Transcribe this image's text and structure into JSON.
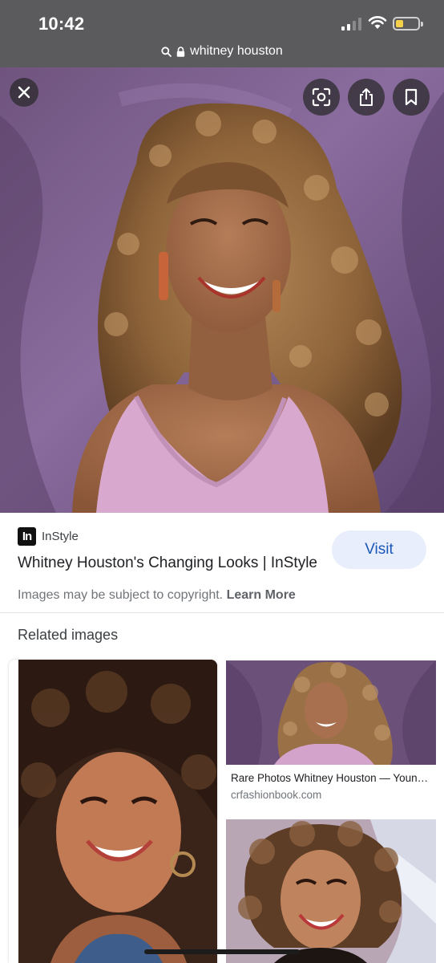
{
  "status": {
    "time": "10:42",
    "battery_level": 0.35,
    "battery_color": "#f5d04a",
    "icons": [
      "signal-icon",
      "wifi-icon",
      "battery-icon"
    ]
  },
  "url_bar": {
    "text": "whitney houston",
    "icons": [
      "search-icon",
      "lock-icon"
    ]
  },
  "hero": {
    "image": "smiling-woman-curly-hair-portrait",
    "buttons": [
      "close-icon",
      "lens-icon",
      "share-icon",
      "bookmark-icon"
    ]
  },
  "source": {
    "logo_text": "In",
    "name": "InStyle",
    "title": "Whitney Houston's Changing Looks | InStyle",
    "visit_label": "Visit",
    "copyright_text": "Images may be subject to copyright.",
    "learn_more": "Learn More"
  },
  "related": {
    "title": "Related images",
    "items": [
      {
        "image": "woman-curly-hair-close-up",
        "caption": "",
        "domain": ""
      },
      {
        "image": "woman-curly-hair-purple-backdrop",
        "caption": "Rare Photos Whitney Houston — Young Hollywood Looks",
        "domain": "crfashionbook.com"
      },
      {
        "image": "woman-curly-hair-bold-makeup",
        "caption": "",
        "domain": ""
      }
    ]
  },
  "colors": {
    "topbar": "#5b5b5d",
    "visit_button_bg": "#e8eefb",
    "visit_button_text": "#1a56b8",
    "backdrop_purple": "#7d6190"
  }
}
